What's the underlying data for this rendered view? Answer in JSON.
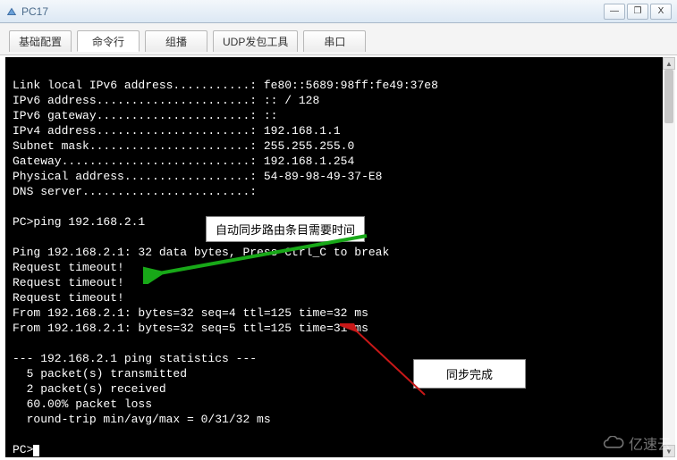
{
  "window": {
    "title": "PC17",
    "min_icon": "—",
    "max_icon": "❐",
    "close_icon": "X"
  },
  "tabs": {
    "items": [
      {
        "label": "基础配置"
      },
      {
        "label": "命令行",
        "active": true
      },
      {
        "label": "组播"
      },
      {
        "label": "UDP发包工具"
      },
      {
        "label": "串口"
      }
    ]
  },
  "terminal": {
    "lines": [
      "",
      "Link local IPv6 address...........: fe80::5689:98ff:fe49:37e8",
      "IPv6 address......................: :: / 128",
      "IPv6 gateway......................: ::",
      "IPv4 address......................: 192.168.1.1",
      "Subnet mask.......................: 255.255.255.0",
      "Gateway...........................: 192.168.1.254",
      "Physical address..................: 54-89-98-49-37-E8",
      "DNS server........................:",
      "",
      "PC>ping 192.168.2.1",
      "",
      "Ping 192.168.2.1: 32 data bytes, Press Ctrl_C to break",
      "Request timeout!",
      "Request timeout!",
      "Request timeout!",
      "From 192.168.2.1: bytes=32 seq=4 ttl=125 time=32 ms",
      "From 192.168.2.1: bytes=32 seq=5 ttl=125 time=31 ms",
      "",
      "--- 192.168.2.1 ping statistics ---",
      "  5 packet(s) transmitted",
      "  2 packet(s) received",
      "  60.00% packet loss",
      "  round-trip min/avg/max = 0/31/32 ms",
      "",
      "PC>"
    ]
  },
  "annotations": {
    "sync_needed": "自动同步路由条目需要时间",
    "sync_done": "同步完成"
  },
  "watermark": {
    "text": "亿速云"
  },
  "colors": {
    "arrow_green": "#18a818",
    "arrow_red": "#c81818"
  }
}
